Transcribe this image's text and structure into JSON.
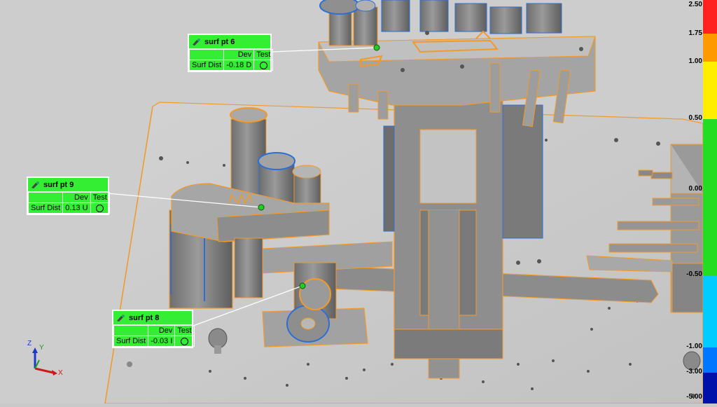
{
  "callouts": [
    {
      "title": "surf pt 6",
      "head_dev": "Dev",
      "head_test": "Test",
      "row_label": "Surf Dist",
      "row_value": "-0.18 D"
    },
    {
      "title": "surf pt 9",
      "head_dev": "Dev",
      "head_test": "Test",
      "row_label": "Surf Dist",
      "row_value": "0.13 U"
    },
    {
      "title": "surf pt 8",
      "head_dev": "Dev",
      "head_test": "Test",
      "row_label": "Surf Dist",
      "row_value": "-0.03 I"
    }
  ],
  "color_scale": {
    "labels": [
      "2.50",
      "1.75",
      "1.00",
      "0.50",
      "0.00",
      "-0.50",
      "-1.00",
      "-3.00",
      "-5.00"
    ],
    "colors": {
      "red": "#ff2020",
      "orange": "#ff9900",
      "yellow": "#ffee00",
      "green": "#22dd22",
      "cyan": "#00ccff",
      "blue": "#0077ff",
      "navy": "#0011aa"
    }
  },
  "triad": {
    "x": "X",
    "y": "Y",
    "z": "Z"
  },
  "icons": [
    "probe-icon",
    "test-status-circle-icon",
    "axis-triad-icon"
  ]
}
